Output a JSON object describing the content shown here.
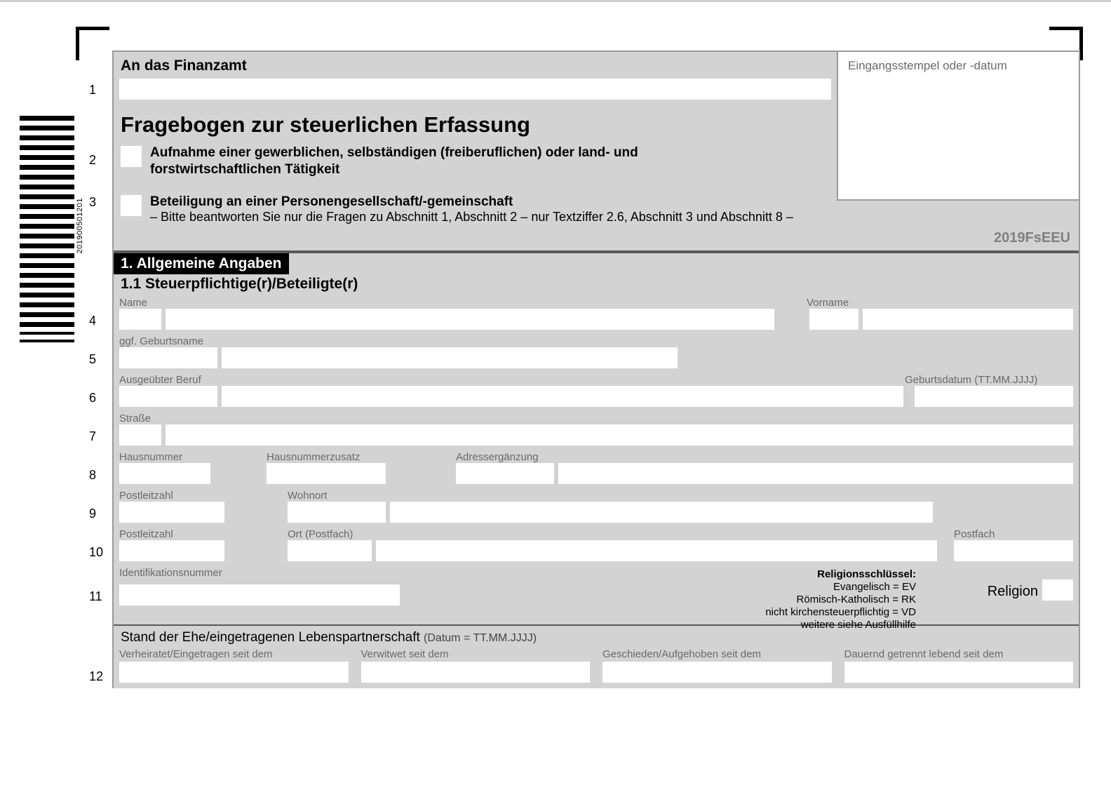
{
  "barcode_number": "201900501201",
  "header": {
    "finanzamt_label": "An das Finanzamt",
    "stamp_label": "Eingangsstempel oder -datum",
    "title": "Fragebogen zur steuerlichen Erfassung",
    "q2_text": "Aufnahme einer gewerblichen, selbständigen (freiberuflichen) oder land- und forstwirtschaftlichen Tätigkeit",
    "q3_text": "Beteiligung an einer Personengesellschaft/-gemeinschaft",
    "q3_sub": "– Bitte beantworten Sie nur die Fragen zu Abschnitt 1, Abschnitt 2 – nur Textziffer 2.6, Abschnitt 3 und Abschnitt 8 –",
    "form_code": "2019FsEEU"
  },
  "section1": {
    "number_title": "1. Allgemeine Angaben",
    "subtitle": "1.1 Steuerpflichtige(r)/Beteiligte(r)"
  },
  "fields": {
    "name": "Name",
    "vorname": "Vorname",
    "geburtsname": "ggf. Geburtsname",
    "beruf": "Ausgeübter Beruf",
    "geburtsdatum": "Geburtsdatum (TT.MM.JJJJ)",
    "strasse": "Straße",
    "hausnummer": "Hausnummer",
    "hausnummerzusatz": "Hausnummerzusatz",
    "adresserg": "Adressergänzung",
    "plz": "Postleitzahl",
    "wohnort": "Wohnort",
    "plz2": "Postleitzahl",
    "ort_postfach": "Ort (Postfach)",
    "postfach": "Postfach",
    "idnr": "Identifikationsnummer"
  },
  "religion": {
    "title": "Religionsschlüssel:",
    "ev": "Evangelisch = EV",
    "rk": "Römisch-Katholisch = RK",
    "vd": "nicht kirchensteuerpflichtig = VD",
    "more": "weitere siehe Ausfüllhilfe",
    "label": "Religion"
  },
  "marital": {
    "header": "Stand der Ehe/eingetragenen Lebenspartnerschaft",
    "header_sub": "(Datum = TT.MM.JJJJ)",
    "verheiratet": "Verheiratet/Eingetragen seit dem",
    "verwitwet": "Verwitwet seit dem",
    "geschieden": "Geschieden/Aufgehoben seit dem",
    "getrennt": "Dauernd getrennt lebend seit dem"
  },
  "line_numbers": [
    "1",
    "2",
    "3",
    "4",
    "5",
    "6",
    "7",
    "8",
    "9",
    "10",
    "11",
    "12"
  ]
}
